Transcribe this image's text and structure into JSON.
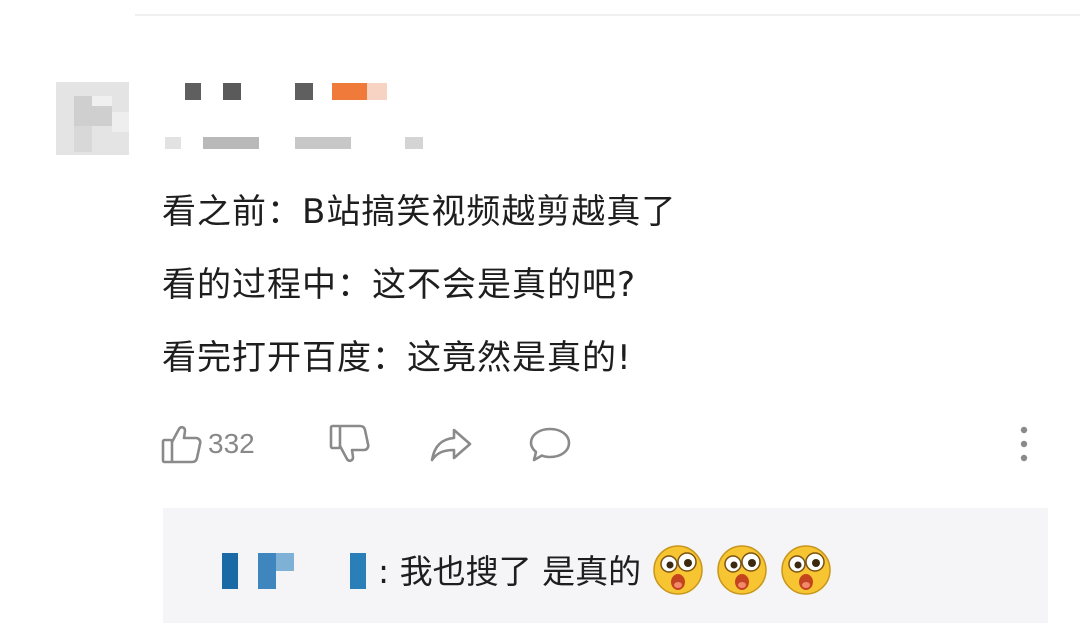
{
  "comment": {
    "lines": [
      "看之前：B站搞笑视频越剪越真了",
      "看的过程中：这不会是真的吧?",
      "看完打开百度：这竟然是真的!"
    ]
  },
  "actions": {
    "like_count": "332",
    "like_icon": "thumbs-up-icon",
    "dislike_icon": "thumbs-down-icon",
    "share_icon": "share-icon",
    "comment_icon": "comment-icon",
    "more_icon": "more-vertical-icon"
  },
  "reply": {
    "text": ": 我也搜了  是真的",
    "emoji": [
      "shocked-emoji-icon",
      "shocked-emoji-icon",
      "shocked-emoji-icon"
    ]
  },
  "colors": {
    "accent": "#f07a3a",
    "icon_gray": "#8a8a8a",
    "reply_bg": "#f5f5f7",
    "reply_name_blue": "#2a7fb8"
  }
}
